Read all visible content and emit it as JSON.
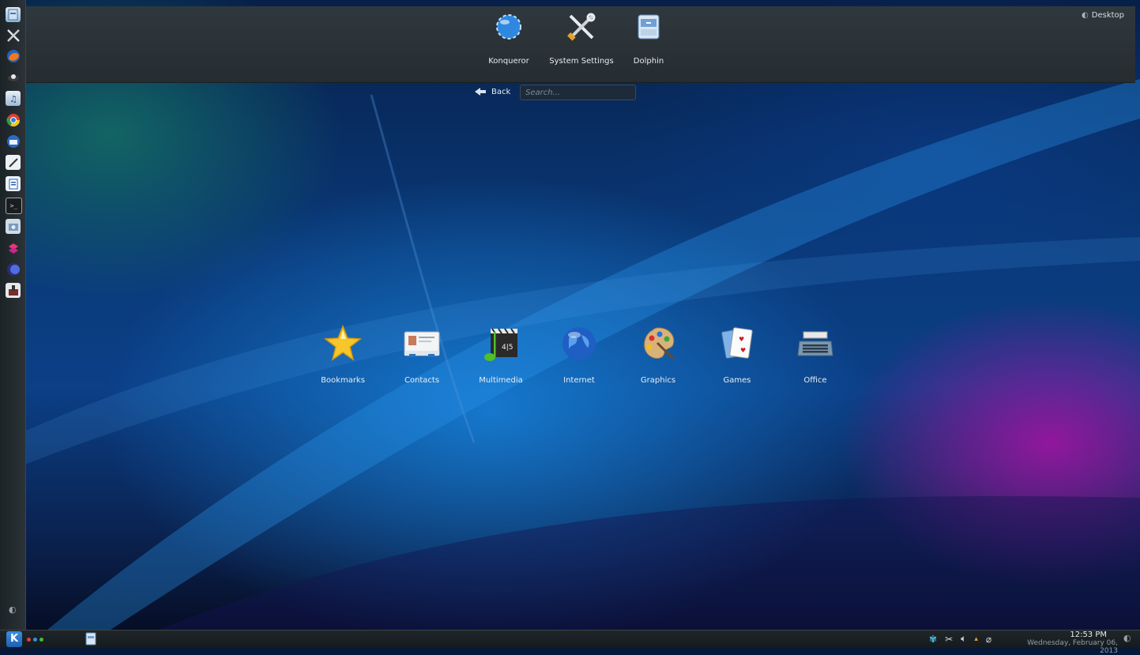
{
  "top_panel": {
    "favorites": [
      {
        "label": "Konqueror",
        "icon": "konqueror-icon"
      },
      {
        "label": "System Settings",
        "icon": "system-settings-icon"
      },
      {
        "label": "Dolphin",
        "icon": "dolphin-icon"
      }
    ],
    "desktop_label": "Desktop"
  },
  "nav": {
    "back_label": "Back",
    "search_placeholder": "Search..."
  },
  "categories": [
    {
      "label": "Bookmarks",
      "icon": "star-icon"
    },
    {
      "label": "Contacts",
      "icon": "contacts-icon"
    },
    {
      "label": "Multimedia",
      "icon": "multimedia-icon"
    },
    {
      "label": "Internet",
      "icon": "globe-icon"
    },
    {
      "label": "Graphics",
      "icon": "palette-icon"
    },
    {
      "label": "Games",
      "icon": "cards-icon"
    },
    {
      "label": "Office",
      "icon": "typewriter-icon"
    }
  ],
  "left_launchers": [
    "dolphin-icon",
    "system-settings-icon",
    "firefox-icon",
    "pirate-icon",
    "music-icon",
    "chrome-icon",
    "thunderbird-icon",
    "text-editor-icon",
    "document-icon",
    "terminal-icon",
    "screenshot-icon",
    "sync-icon",
    "eclipse-icon",
    "install-icon"
  ],
  "taskbar": {
    "kmenu_label": "K",
    "clock_time": "12:53 PM",
    "clock_date": "Wednesday, February 06, 2013"
  },
  "colors": {
    "panel_bg": "#2b3338",
    "accent": "#3a8ee0",
    "wallpaper_blue": "#0b3f86",
    "wallpaper_purple": "#a014a0"
  }
}
